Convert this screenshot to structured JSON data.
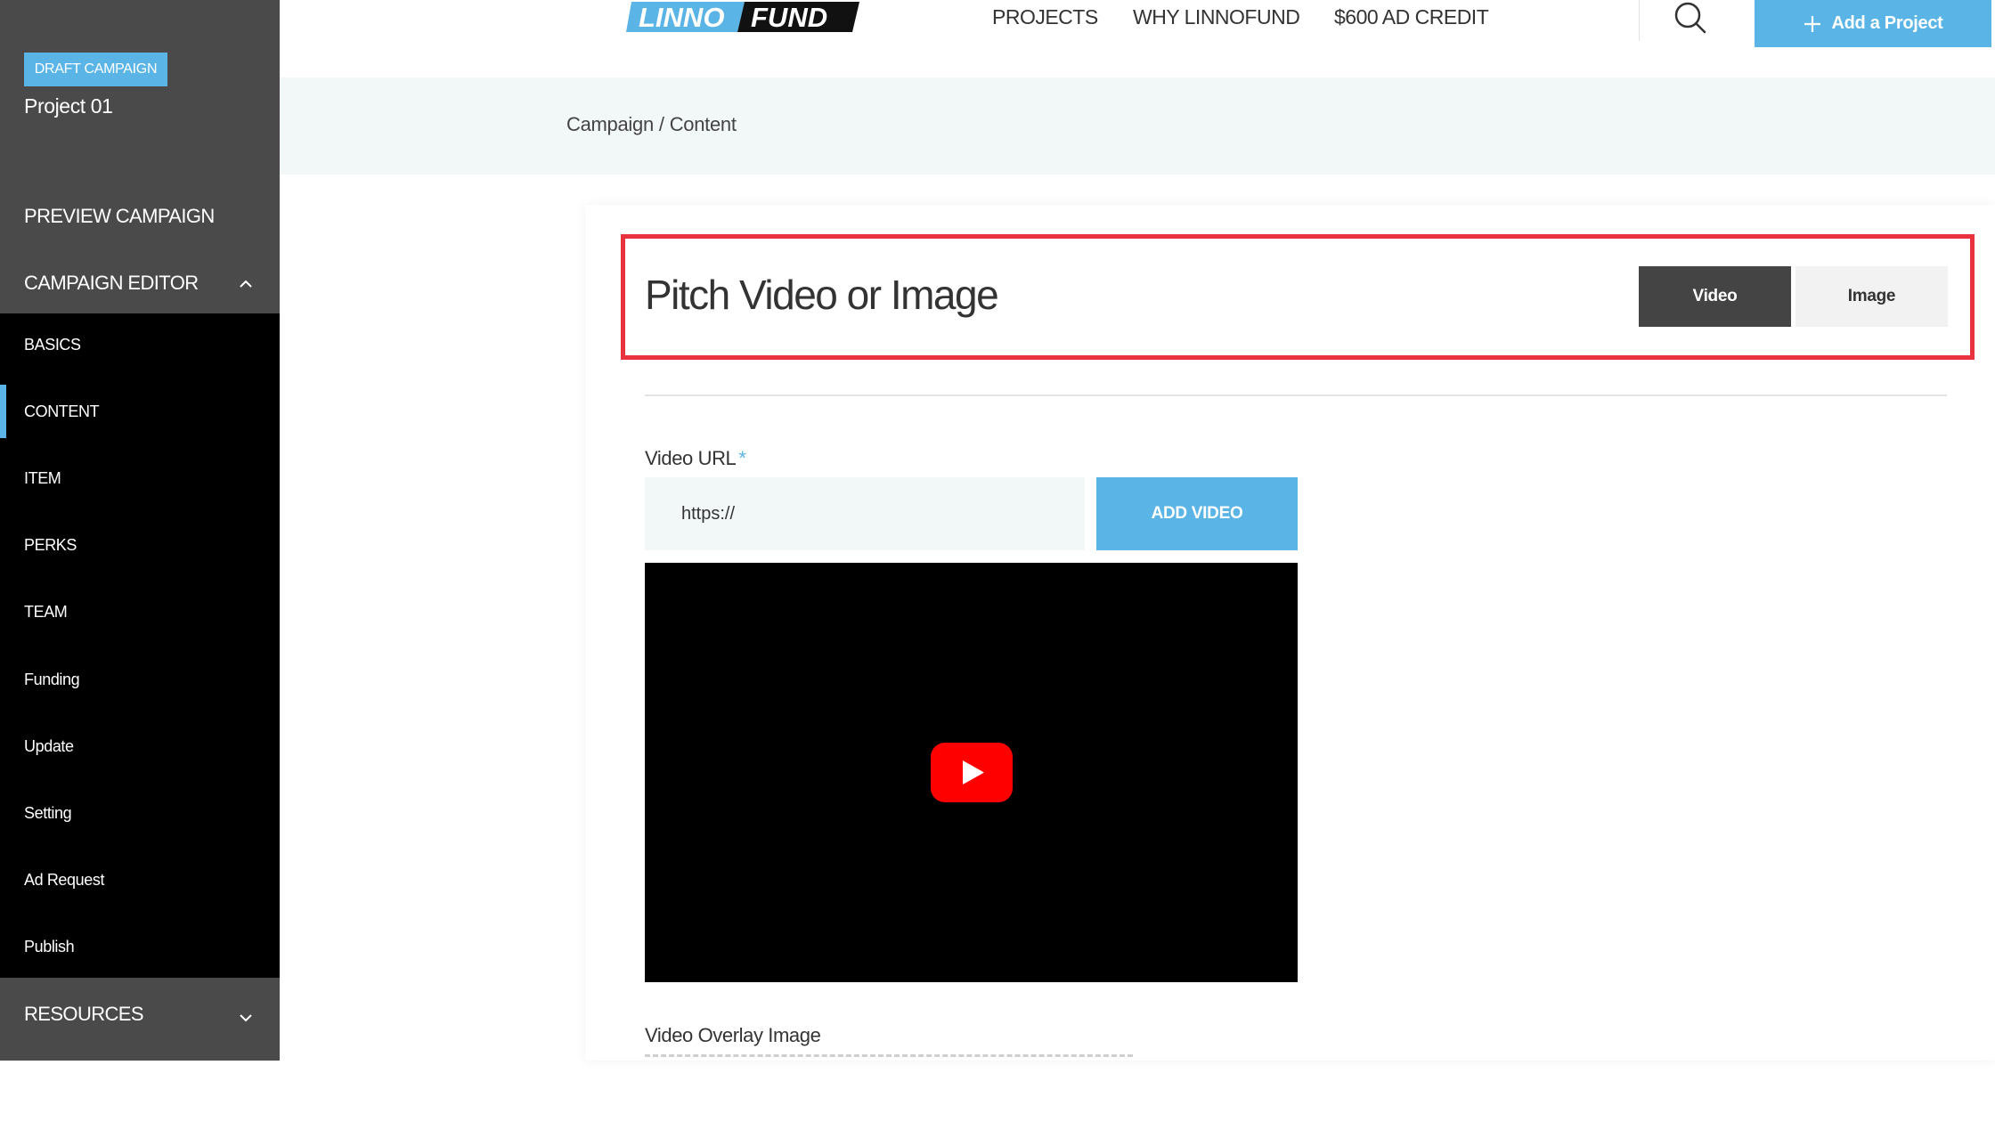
{
  "header": {
    "logo_text_left": "LINNO",
    "logo_text_right": "FUND",
    "nav": [
      {
        "label": "PROJECTS"
      },
      {
        "label": "WHY LINNOFUND"
      },
      {
        "label": "$600 AD CREDIT"
      }
    ],
    "add_project_label": "Add a Project"
  },
  "sidebar": {
    "badge": "DRAFT CAMPAIGN",
    "project_name": "Project 01",
    "preview_label": "PREVIEW CAMPAIGN",
    "editor_label": "CAMPAIGN EDITOR",
    "items": [
      {
        "label": "BASICS"
      },
      {
        "label": "CONTENT"
      },
      {
        "label": "ITEM"
      },
      {
        "label": "PERKS"
      },
      {
        "label": "TEAM"
      },
      {
        "label": "Funding"
      },
      {
        "label": "Update"
      },
      {
        "label": "Setting"
      },
      {
        "label": "Ad Request"
      },
      {
        "label": "Publish"
      }
    ],
    "resources_label": "RESOURCES"
  },
  "breadcrumb": {
    "parts": [
      "Campaign",
      "Content"
    ],
    "separator": "/"
  },
  "content": {
    "section_title": "Pitch Video or Image",
    "tabs": [
      {
        "label": "Video",
        "active": true
      },
      {
        "label": "Image",
        "active": false
      }
    ],
    "video_url_label": "Video URL",
    "required_mark": "*",
    "video_url_value": "https://",
    "add_video_label": "ADD VIDEO",
    "overlay_label": "Video Overlay Image"
  },
  "colors": {
    "accent": "#5ab4e5",
    "sidebar_dark": "#000000",
    "sidebar_gray": "#4a4a4a",
    "highlight": "#e8323d",
    "youtube_red": "#ff0000"
  }
}
